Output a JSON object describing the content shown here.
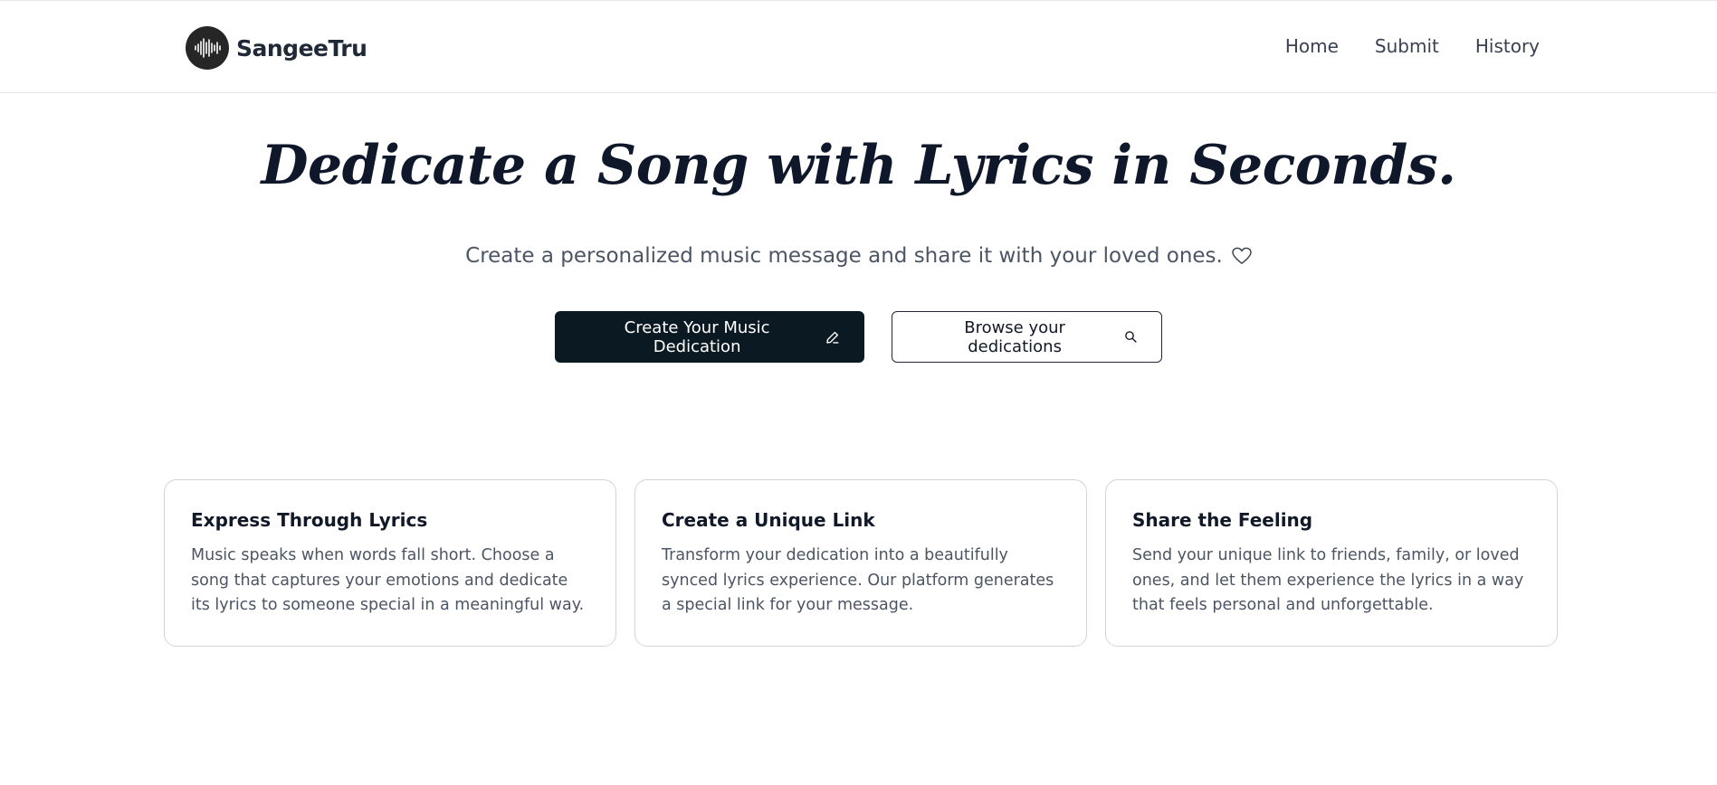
{
  "header": {
    "brand": "SangeeTru",
    "nav": [
      {
        "label": "Home"
      },
      {
        "label": "Submit"
      },
      {
        "label": "History"
      }
    ]
  },
  "hero": {
    "title": "Dedicate a Song with Lyrics in Seconds.",
    "subtitle": "Create a personalized music message and share it with your loved ones.",
    "primary_button": "Create Your Music Dedication",
    "secondary_button": "Browse your dedications"
  },
  "features": [
    {
      "title": "Express Through Lyrics",
      "text": "Music speaks when words fall short. Choose a song that captures your emotions and dedicate its lyrics to someone special in a meaningful way."
    },
    {
      "title": "Create a Unique Link",
      "text": "Transform your dedication into a beautifully synced lyrics experience. Our platform generates a special link for your message."
    },
    {
      "title": "Share the Feeling",
      "text": "Send your unique link to friends, family, or loved ones, and let them experience the lyrics in a way that feels personal and unforgettable."
    }
  ],
  "icons": {
    "logo": "soundwave-icon",
    "subtitle": "heart-icon",
    "primary_button": "pencil-icon",
    "secondary_button": "search-icon"
  },
  "colors": {
    "primary": "#0b1a22",
    "text": "#111827",
    "muted": "#4b5563",
    "border": "#d1d5db"
  }
}
